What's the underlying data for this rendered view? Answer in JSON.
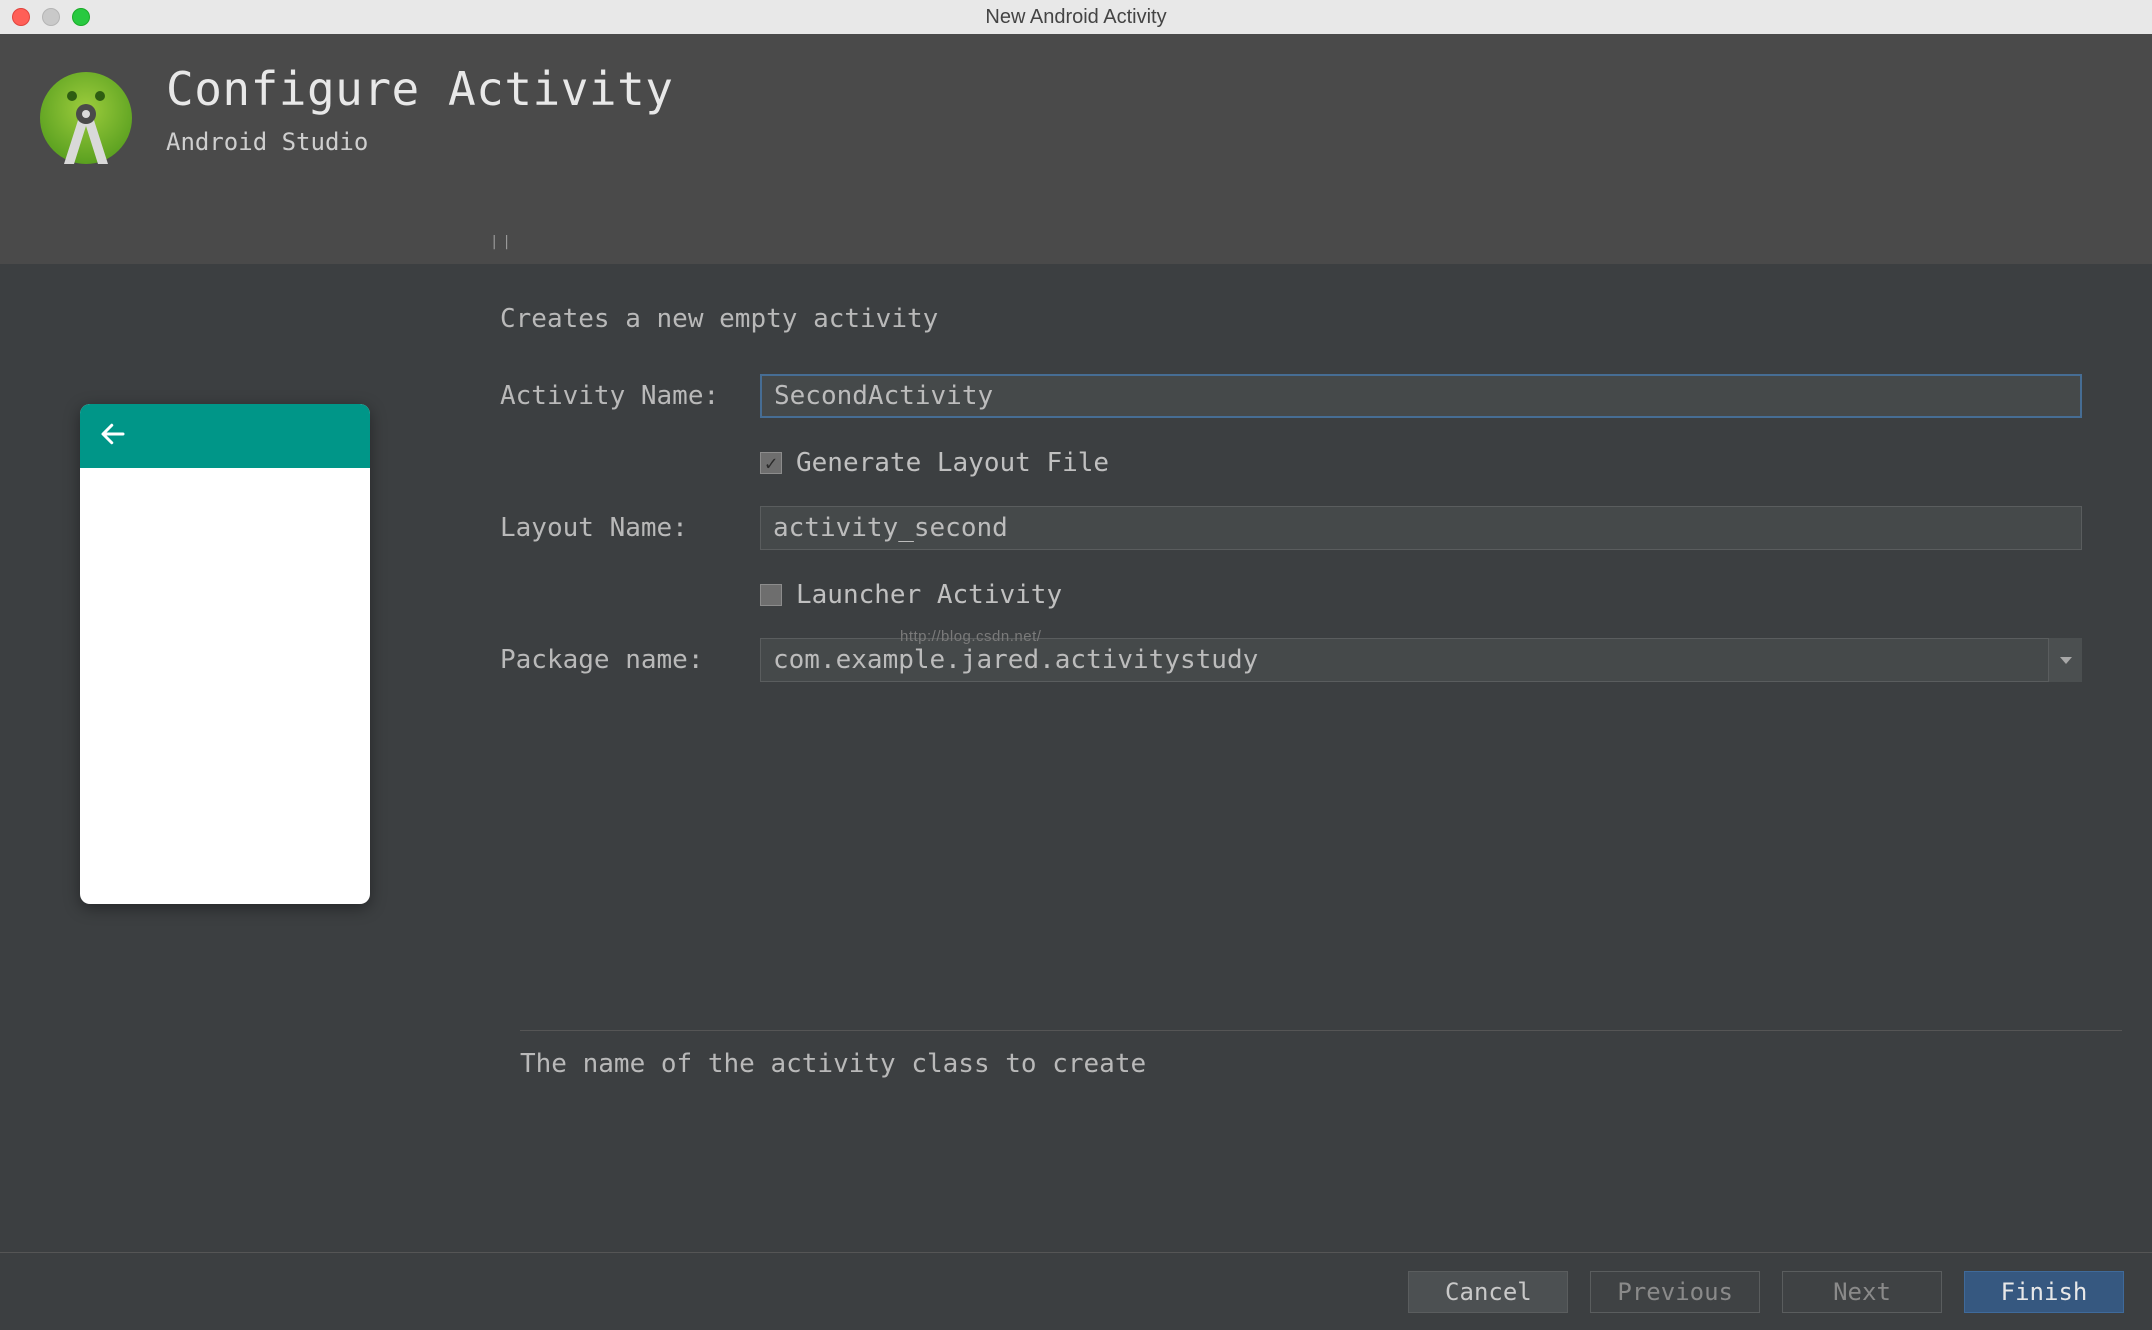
{
  "window": {
    "title": "New Android Activity"
  },
  "header": {
    "title": "Configure Activity",
    "subtitle": "Android Studio"
  },
  "form": {
    "description": "Creates a new empty activity",
    "activity_name_label": "Activity Name:",
    "activity_name_value": "SecondActivity",
    "generate_layout_label": "Generate Layout File",
    "generate_layout_checked": true,
    "layout_name_label": "Layout Name:",
    "layout_name_value": "activity_second",
    "launcher_activity_label": "Launcher Activity",
    "launcher_activity_checked": false,
    "package_name_label": "Package name:",
    "package_name_value": "com.example.jared.activitystudy"
  },
  "help": {
    "text": "The name of the activity class to create"
  },
  "footer": {
    "cancel": "Cancel",
    "previous": "Previous",
    "next": "Next",
    "finish": "Finish"
  },
  "watermark": "http://blog.csdn.net/"
}
